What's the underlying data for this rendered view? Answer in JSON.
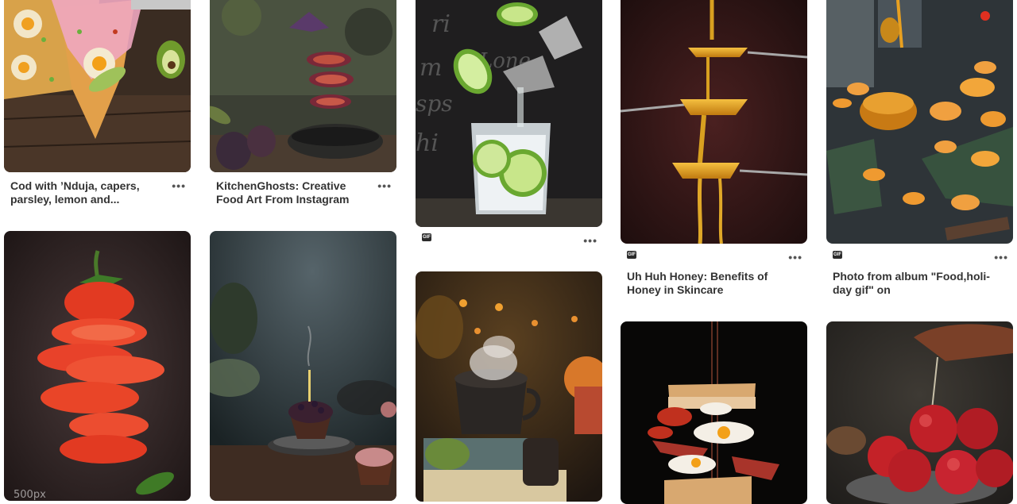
{
  "pins": [
    {
      "title": "Cod with ’Nduja, capers, parsley, lemon and...",
      "gif": false
    },
    {
      "title": "KitchenGhosts: Creative Food Art From Instagram",
      "gif": false
    },
    {
      "title": "",
      "gif": true,
      "gif_label": "GIF"
    },
    {
      "title": "Uh Huh Honey: Benefits of Honey in Skincare",
      "gif": true,
      "gif_label": "GIF"
    },
    {
      "title": "Photo from album \"Food,holi-day gif\" on",
      "gif": true,
      "gif_label": "GIF"
    },
    {
      "title": "",
      "gif": false,
      "watermark": "500px"
    },
    {
      "title": "",
      "gif": false
    },
    {
      "title": "",
      "gif": false
    },
    {
      "title": "",
      "gif": false
    },
    {
      "title": "",
      "gif": false
    }
  ],
  "more_label": "•••",
  "colors": {
    "background": "#ffffff",
    "title": "#333333"
  }
}
